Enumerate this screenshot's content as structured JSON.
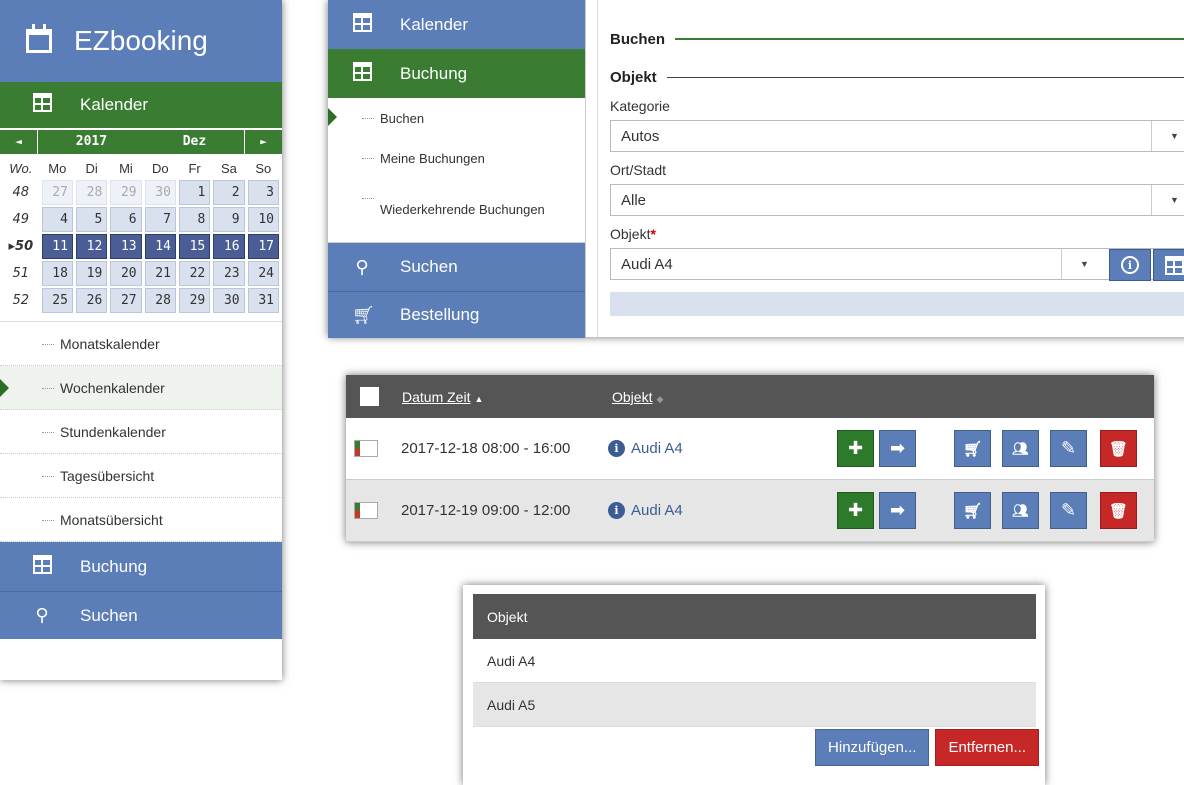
{
  "sidebar": {
    "brand": "EZbooking",
    "nav_kalender": "Kalender",
    "calendar": {
      "year": "2017",
      "month": "Dez",
      "prev_arrow": "◄",
      "next_arrow": "►",
      "week_header": "Wo.",
      "days": [
        "Mo",
        "Di",
        "Mi",
        "Do",
        "Fr",
        "Sa",
        "So"
      ],
      "weeks": [
        {
          "wk": "48",
          "cells": [
            "27",
            "28",
            "29",
            "30",
            "1",
            "2",
            "3"
          ]
        },
        {
          "wk": "49",
          "cells": [
            "4",
            "5",
            "6",
            "7",
            "8",
            "9",
            "10"
          ]
        },
        {
          "wk": "50",
          "cells": [
            "11",
            "12",
            "13",
            "14",
            "15",
            "16",
            "17"
          ]
        },
        {
          "wk": "51",
          "cells": [
            "18",
            "19",
            "20",
            "21",
            "22",
            "23",
            "24"
          ]
        },
        {
          "wk": "52",
          "cells": [
            "25",
            "26",
            "27",
            "28",
            "29",
            "30",
            "31"
          ]
        }
      ]
    },
    "subitems": [
      "Monatskalender",
      "Wochenkalender",
      "Stundenkalender",
      "Tagesübersicht",
      "Monatsübersicht"
    ],
    "nav_buchung": "Buchung",
    "nav_suchen": "Suchen"
  },
  "booking": {
    "nav": {
      "kalender": "Kalender",
      "buchung": "Buchung",
      "sub": [
        "Buchen",
        "Meine Buchungen",
        "Wiederkehrende Buchungen"
      ],
      "suchen": "Suchen",
      "bestellung": "Bestellung"
    },
    "form": {
      "legend": "Buchen",
      "sublegend": "Objekt",
      "kategorie_label": "Kategorie",
      "kategorie_value": "Autos",
      "ort_label": "Ort/Stadt",
      "ort_value": "Alle",
      "objekt_label": "Objekt",
      "objekt_required": "*",
      "objekt_value": "Audi A4"
    }
  },
  "bookings_table": {
    "col_datum": "Datum Zeit",
    "col_objekt": "Objekt",
    "rows": [
      {
        "datetime": "2017-12-18 08:00 - 16:00",
        "object": "Audi A4"
      },
      {
        "datetime": "2017-12-19 09:00 - 12:00",
        "object": "Audi A4"
      }
    ]
  },
  "object_list": {
    "header": "Objekt",
    "items": [
      "Audi A4",
      "Audi A5"
    ],
    "add_label": "Hinzufügen...",
    "remove_label": "Entfernen..."
  },
  "colors": {
    "blue": "#5b7db8",
    "green": "#3a7d32",
    "red": "#c62828",
    "selected_week": "#4a5d94"
  }
}
